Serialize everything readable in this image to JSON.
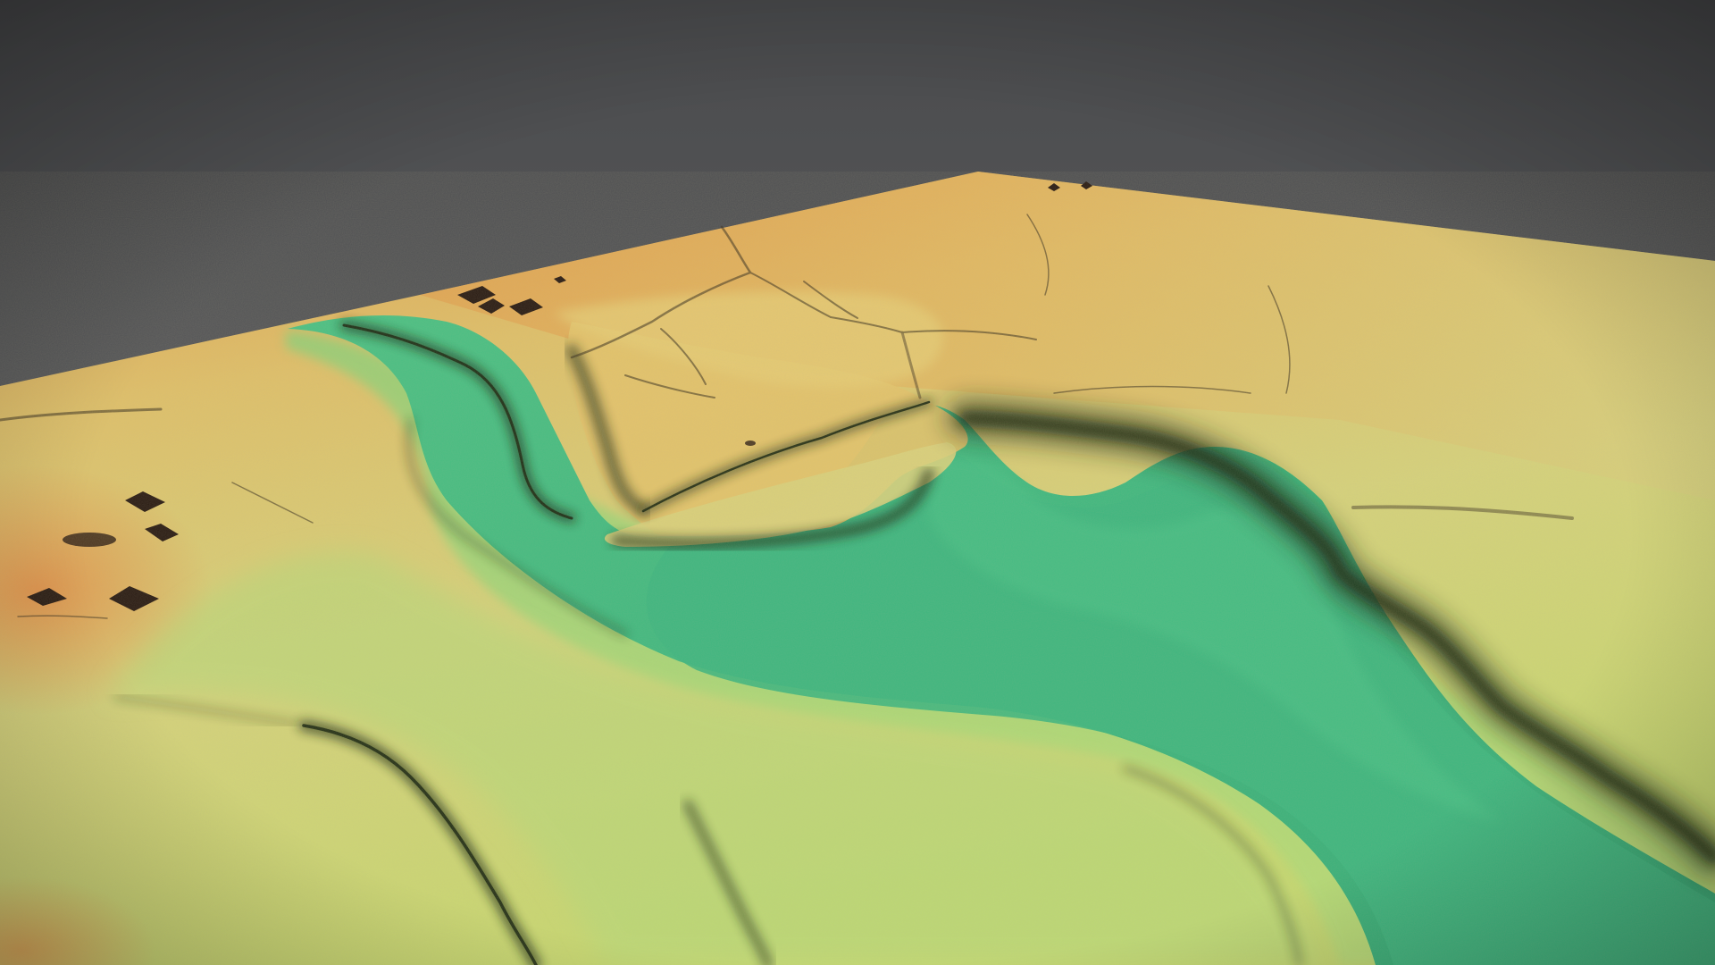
{
  "scene": {
    "kind": "3d-lidar-terrain-elevation-render",
    "caption": ""
  },
  "colors": {
    "background_top": "#4a4b4d",
    "background_bottom": "#6a6b6d",
    "elevation_high": "#e0a050",
    "elevation_mid": "#dcd47e",
    "elevation_low_land": "#a6dc78",
    "river_bed": "#3fb980",
    "river_bed_deep": "#35ab74",
    "bank_shadow": "#1e2a14",
    "building": "#2a1c14"
  },
  "icons": {
    "buildings": "building-block-icon"
  }
}
